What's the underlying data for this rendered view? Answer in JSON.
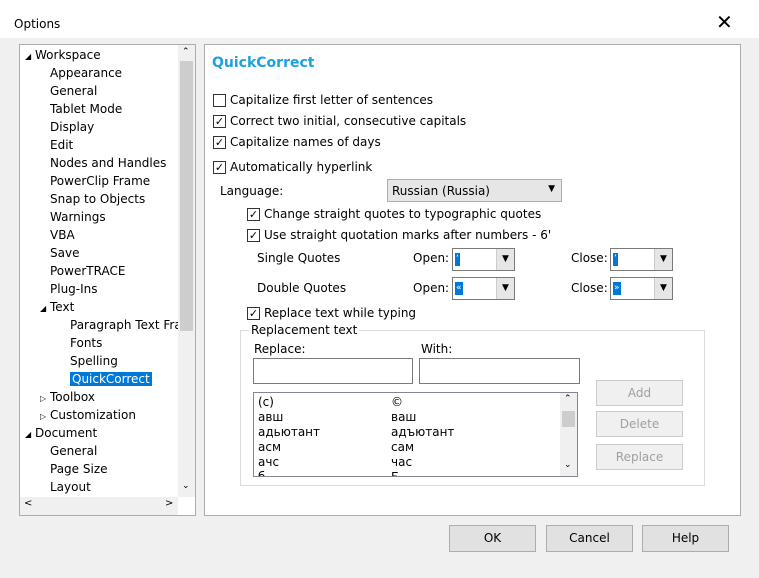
{
  "window": {
    "title": "Options"
  },
  "tree": [
    {
      "label": "Workspace",
      "level": 0,
      "twisty": "open"
    },
    {
      "label": "Appearance",
      "level": 1
    },
    {
      "label": "General",
      "level": 1
    },
    {
      "label": "Tablet Mode",
      "level": 1
    },
    {
      "label": "Display",
      "level": 1
    },
    {
      "label": "Edit",
      "level": 1
    },
    {
      "label": "Nodes and Handles",
      "level": 1
    },
    {
      "label": "PowerClip Frame",
      "level": 1
    },
    {
      "label": "Snap to Objects",
      "level": 1
    },
    {
      "label": "Warnings",
      "level": 1
    },
    {
      "label": "VBA",
      "level": 1
    },
    {
      "label": "Save",
      "level": 1
    },
    {
      "label": "PowerTRACE",
      "level": 1
    },
    {
      "label": "Plug-Ins",
      "level": 1
    },
    {
      "label": "Text",
      "level": 1,
      "twisty": "open"
    },
    {
      "label": "Paragraph Text Fra...",
      "level": 2
    },
    {
      "label": "Fonts",
      "level": 2
    },
    {
      "label": "Spelling",
      "level": 2
    },
    {
      "label": "QuickCorrect",
      "level": 2,
      "selected": true
    },
    {
      "label": "Toolbox",
      "level": 1,
      "twisty": "closed"
    },
    {
      "label": "Customization",
      "level": 1,
      "twisty": "closed"
    },
    {
      "label": "Document",
      "level": 0,
      "twisty": "open"
    },
    {
      "label": "General",
      "level": 1
    },
    {
      "label": "Page Size",
      "level": 1
    },
    {
      "label": "Layout",
      "level": 1
    }
  ],
  "panel": {
    "heading": "QuickCorrect",
    "cap_first": {
      "label": "Capitalize first letter of sentences",
      "checked": false
    },
    "two_caps": {
      "label": "Correct two initial, consecutive capitals",
      "checked": true
    },
    "cap_days": {
      "label": "Capitalize names of days",
      "checked": true
    },
    "hyperlink": {
      "label": "Automatically hyperlink",
      "checked": true
    },
    "language_label": "Language:",
    "language_value": "Russian (Russia)",
    "typo_quotes": {
      "label": "Change straight quotes to typographic quotes",
      "checked": true
    },
    "straight_numbers": {
      "label": "Use straight quotation marks after numbers - 6'",
      "checked": true
    },
    "single_label": "Single Quotes",
    "double_label": "Double Quotes",
    "open_label": "Open:",
    "close_label": "Close:",
    "single_open": "‘",
    "single_close": "’",
    "double_open": "«",
    "double_close": "»",
    "replace_typing": {
      "label": "Replace text while typing",
      "checked": true
    },
    "group_label": "Replacement text",
    "replace_label": "Replace:",
    "with_label": "With:",
    "replace_value": "",
    "with_value": "",
    "list": [
      [
        "(c)",
        "©"
      ],
      [
        "авш",
        "ваш"
      ],
      [
        "адьютант",
        "адъютант"
      ],
      [
        "асм",
        "сам"
      ],
      [
        "ачс",
        "час"
      ],
      [
        "б",
        "Б"
      ]
    ],
    "add": "Add",
    "delete": "Delete",
    "replace": "Replace"
  },
  "footer": {
    "ok": "OK",
    "cancel": "Cancel",
    "help": "Help"
  },
  "colors": {
    "accent": "#1ba1e2",
    "selection": "#0078d7"
  }
}
